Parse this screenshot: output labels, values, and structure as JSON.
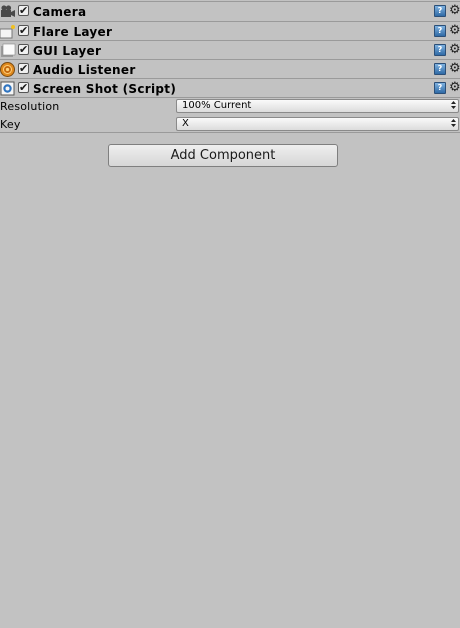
{
  "components": [
    {
      "name": "Camera",
      "icon": "camera-icon",
      "enabled": true
    },
    {
      "name": "Flare Layer",
      "icon": "flare-layer-icon",
      "enabled": true
    },
    {
      "name": "GUI Layer",
      "icon": "gui-layer-icon",
      "enabled": true
    },
    {
      "name": "Audio Listener",
      "icon": "audio-listener-icon",
      "enabled": true
    },
    {
      "name": "Screen Shot (Script)",
      "icon": "script-icon",
      "enabled": true
    }
  ],
  "check_glyph": "✔",
  "help_glyph": "?",
  "gear_glyph": "⚙",
  "arrow_glyph": "▲▼",
  "properties": {
    "resolution": {
      "label": "Resolution",
      "value": "100% Current"
    },
    "key": {
      "label": "Key",
      "value": "X"
    }
  },
  "add_component_label": "Add Component",
  "colors": {
    "background": "#c2c2c2",
    "help_blue": "#2f6aa6",
    "audio_orange": "#e08a1e"
  }
}
